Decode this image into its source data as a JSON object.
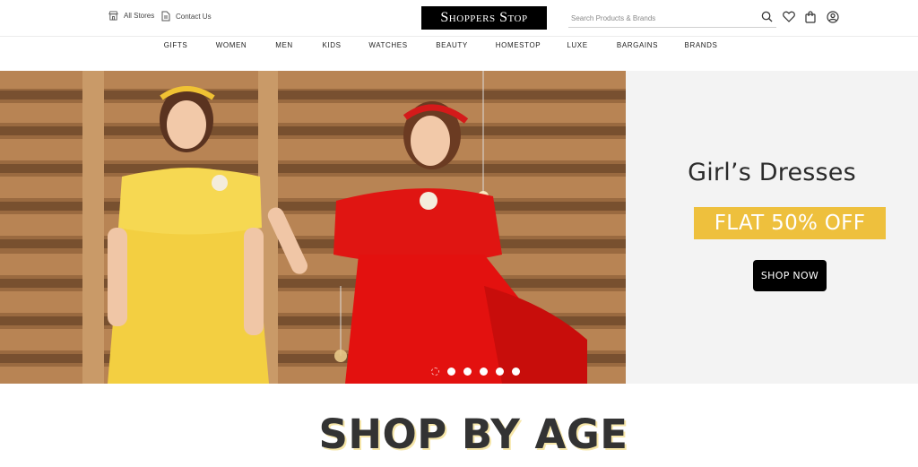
{
  "header": {
    "all_stores": "All Stores",
    "contact_us": "Contact Us",
    "logo": "Shoppers Stop",
    "search_placeholder": "Search Products & Brands",
    "icons": [
      "search-icon",
      "heart-icon",
      "bag-icon",
      "user-icon"
    ]
  },
  "nav": {
    "items": [
      "GIFTS",
      "WOMEN",
      "MEN",
      "KIDS",
      "WATCHES",
      "BEAUTY",
      "HOMESTOP",
      "LUXE",
      "BARGAINS",
      "BRANDS"
    ]
  },
  "hero": {
    "title": "Girl’s Dresses",
    "offer": "FLAT 50% OFF",
    "cta": "SHOP NOW",
    "offer_color": "#EEC03D",
    "slides_total": 6,
    "active_slide": 1
  },
  "section": {
    "title": "SHOP BY AGE"
  }
}
